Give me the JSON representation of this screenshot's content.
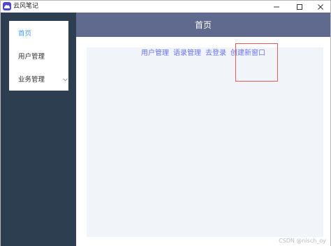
{
  "window": {
    "title": "云风笔记",
    "accent": "#4f46c8"
  },
  "sidebar": {
    "background": "#2c3e50",
    "items": [
      {
        "label": "首页",
        "active": true
      },
      {
        "label": "用户管理",
        "active": false
      },
      {
        "label": "业务管理",
        "active": false,
        "has_submenu": true
      }
    ]
  },
  "header": {
    "title": "首页",
    "background": "#606a8e"
  },
  "main": {
    "links": [
      "用户管理",
      "语录管理",
      "去登录",
      "创建新窗口"
    ],
    "link_color": "#6b73f2"
  },
  "watermark": "CSDN @nisch_oy"
}
